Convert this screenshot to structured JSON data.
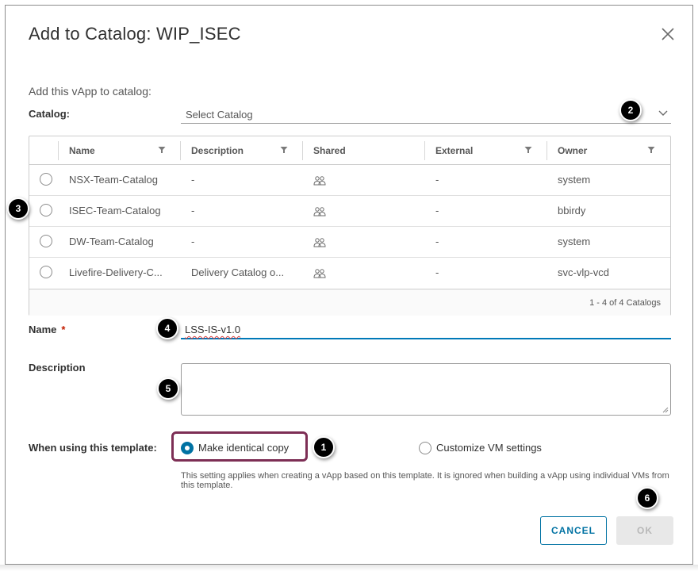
{
  "dialog": {
    "title": "Add to Catalog: WIP_ISEC",
    "subtitle": "Add this vApp to catalog:"
  },
  "catalog": {
    "label": "Catalog:",
    "placeholder": "Select Catalog"
  },
  "grid": {
    "columns": [
      "Name",
      "Description",
      "Shared",
      "External",
      "Owner"
    ],
    "rows": [
      {
        "name": "NSX-Team-Catalog",
        "description": "-",
        "external": "-",
        "owner": "system"
      },
      {
        "name": "ISEC-Team-Catalog",
        "description": "-",
        "external": "-",
        "owner": "bbirdy"
      },
      {
        "name": "DW-Team-Catalog",
        "description": "-",
        "external": "-",
        "owner": "system"
      },
      {
        "name": "Livefire-Delivery-C...",
        "description": "Delivery Catalog o...",
        "external": "-",
        "owner": "svc-vlp-vcd"
      }
    ],
    "footer": "1 - 4 of 4 Catalogs"
  },
  "name_field": {
    "label": "Name",
    "required_mark": "*",
    "value": "LSS-IS-v1.0"
  },
  "description_field": {
    "label": "Description",
    "value": ""
  },
  "template": {
    "label": "When using this template:",
    "option_identical": "Make identical copy",
    "option_customize": "Customize VM settings",
    "selected": "Make identical copy",
    "help": "This setting applies when creating a vApp based on this template. It is ignored when building a vApp using individual VMs from this template."
  },
  "buttons": {
    "cancel": "CANCEL",
    "ok": "OK"
  },
  "callouts": [
    "1",
    "2",
    "3",
    "4",
    "5",
    "6"
  ],
  "colors": {
    "primary": "#0072a3",
    "highlight_border": "#7d2e55",
    "required": "#c21d00",
    "disabled_bg": "#e8e8e8"
  },
  "icons": {
    "close": "close-icon",
    "chevron": "chevron-down-icon",
    "filter": "filter-icon",
    "shared": "shared-users-icon"
  }
}
